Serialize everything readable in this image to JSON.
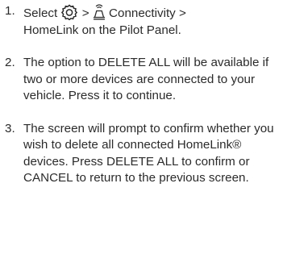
{
  "steps": [
    {
      "number": "1.",
      "part1": "Select",
      "sep1": ">",
      "connectivity": "Connectivity >",
      "line2": "HomeLink on the Pilot Panel.",
      "icons": [
        "gear-icon",
        "connectivity-icon"
      ]
    },
    {
      "number": "2.",
      "text": "The option to DELETE ALL will be available if two or more devices are connected to your vehicle. Press it to continue."
    },
    {
      "number": "3.",
      "text": "The screen will prompt to confirm whether you wish to delete all connected HomeLink® devices. Press DELETE ALL to confirm or CANCEL to return to the previous screen."
    }
  ]
}
